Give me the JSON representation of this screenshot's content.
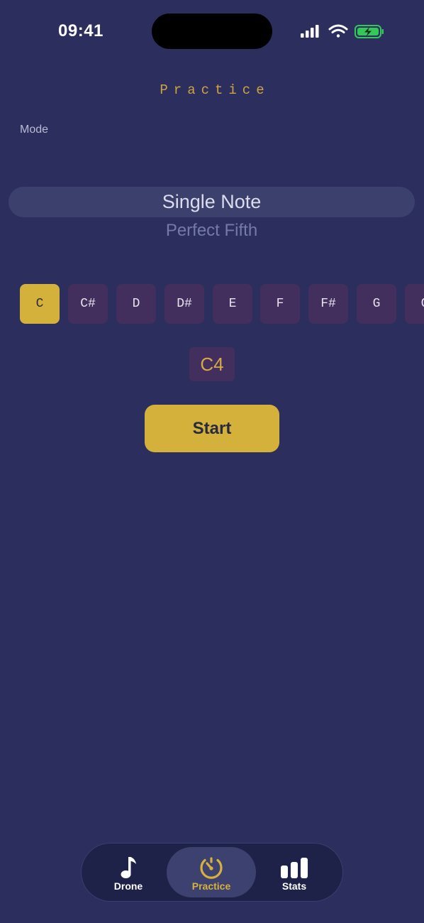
{
  "status_bar": {
    "time": "09:41"
  },
  "page": {
    "title": "Practice"
  },
  "mode": {
    "label": "Mode",
    "selected": "Single Note",
    "next_option": "Perfect Fifth"
  },
  "notes": {
    "items": [
      "C",
      "C#",
      "D",
      "D#",
      "E",
      "F",
      "F#",
      "G",
      "G"
    ],
    "selected": "C"
  },
  "octave": {
    "value": "C4"
  },
  "actions": {
    "start_label": "Start"
  },
  "tab_bar": {
    "tabs": [
      {
        "label": "Drone",
        "icon": "music-note-icon",
        "active": false
      },
      {
        "label": "Practice",
        "icon": "gauge-icon",
        "active": true
      },
      {
        "label": "Stats",
        "icon": "bar-chart-icon",
        "active": false
      }
    ]
  },
  "colors": {
    "background": "#2c2f5e",
    "accent": "#d4b13a",
    "note_inactive": "#432f5e",
    "tab_bar": "#1f2248"
  }
}
